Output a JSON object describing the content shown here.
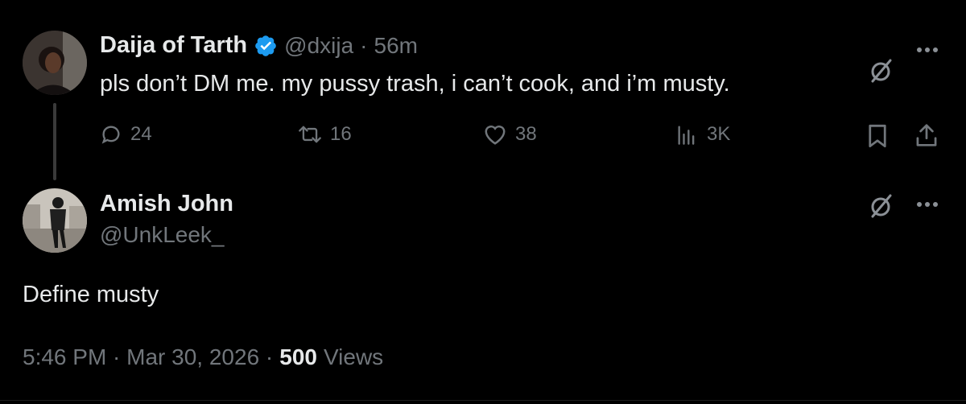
{
  "tweet": {
    "display_name": "Daija of Tarth",
    "handle": "@dxija",
    "separator": "·",
    "time": "56m",
    "text": "pls don’t DM me. my pussy trash, i can’t cook, and i’m musty.",
    "verified": true,
    "actions": {
      "replies": "24",
      "reposts": "16",
      "likes": "38",
      "views": "3K"
    }
  },
  "reply": {
    "display_name": "Amish John",
    "handle": "@UnkLeek_",
    "text": "Define musty",
    "timestamp": "5:46 PM · Mar 30, 2026 ·",
    "views_count": "500",
    "views_label": "Views"
  },
  "icons": {
    "grok": "grok-slash-icon",
    "more": "more-dots-icon",
    "reply": "reply-bubble-icon",
    "repost": "repost-icon",
    "like": "heart-icon",
    "views": "views-bars-icon",
    "bookmark": "bookmark-icon",
    "share": "share-icon",
    "verified": "verified-badge-icon"
  },
  "colors": {
    "background": "#000000",
    "text": "#e7e9ea",
    "muted": "#71767b",
    "verified": "#1d9bf0"
  }
}
